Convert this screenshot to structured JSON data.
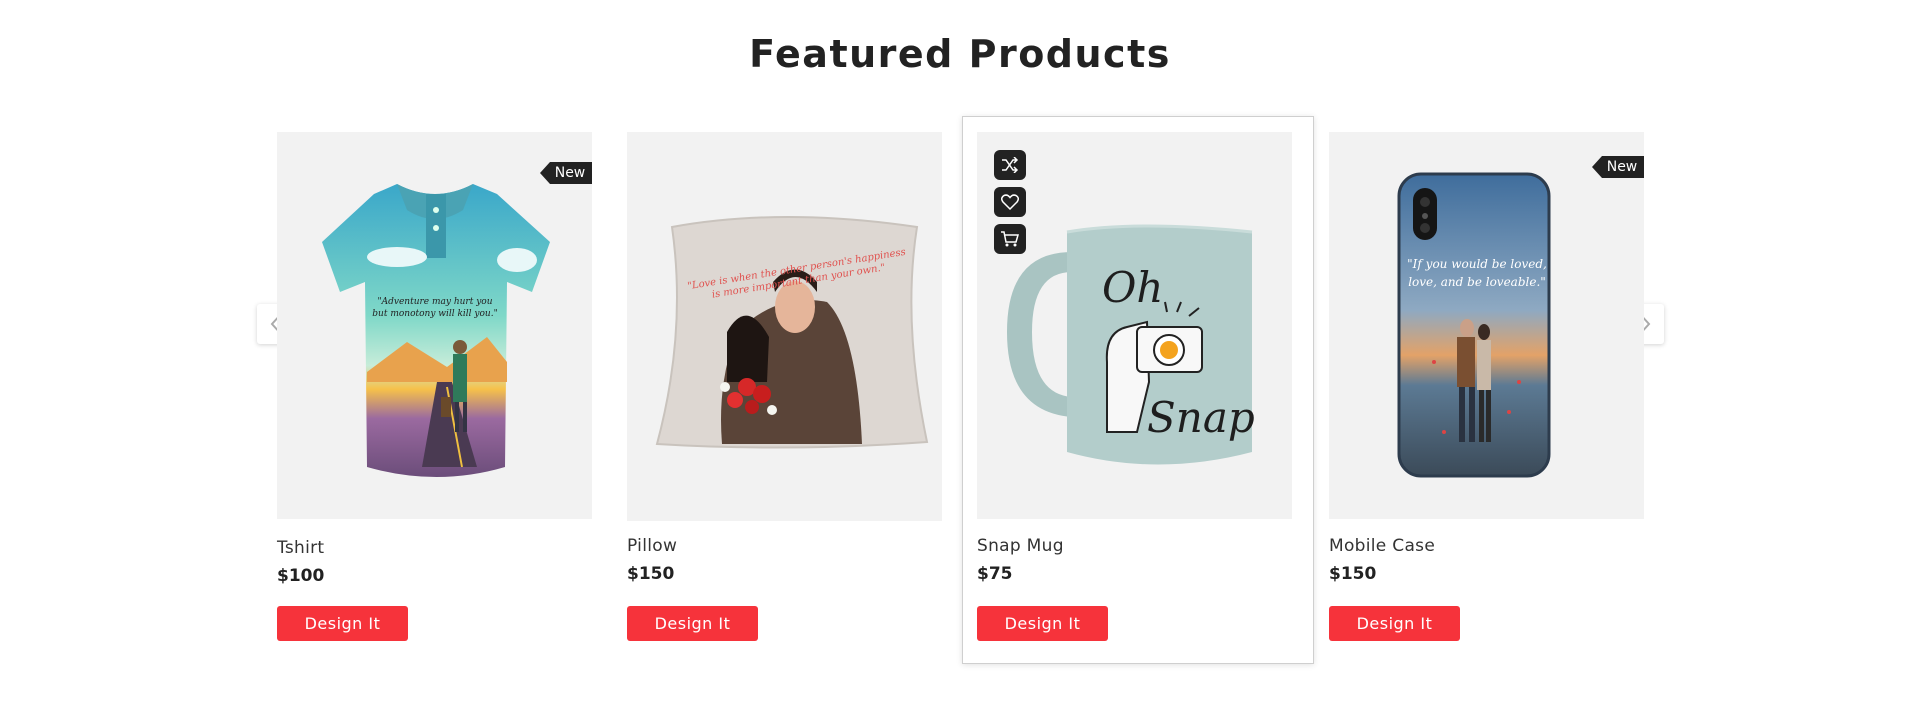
{
  "section": {
    "title": "Featured Products"
  },
  "badges": {
    "new": "New"
  },
  "products": [
    {
      "name": "Tshirt",
      "price": "$100",
      "button": "Design It",
      "quote": [
        "\"Adventure may hurt you",
        "but monotony will kill you.\""
      ]
    },
    {
      "name": "Pillow",
      "price": "$150",
      "button": "Design It",
      "quote": [
        "\"Love is when the other person's happiness",
        "is more important than your own.\""
      ]
    },
    {
      "name": "Snap Mug",
      "price": "$75",
      "button": "Design It",
      "quote": [
        "Oh",
        "Snap"
      ]
    },
    {
      "name": "Mobile Case",
      "price": "$150",
      "button": "Design It",
      "quote": [
        "\"If you would be loved,",
        "love, and be loveable.\""
      ]
    }
  ],
  "icons": {
    "prev": "chevron-left-icon",
    "next": "chevron-right-icon",
    "shuffle": "shuffle-icon",
    "wishlist": "heart-icon",
    "cart": "cart-icon"
  },
  "colors": {
    "accent": "#f6333b",
    "badge": "#222222",
    "thumb_bg": "#f2f2f2"
  }
}
